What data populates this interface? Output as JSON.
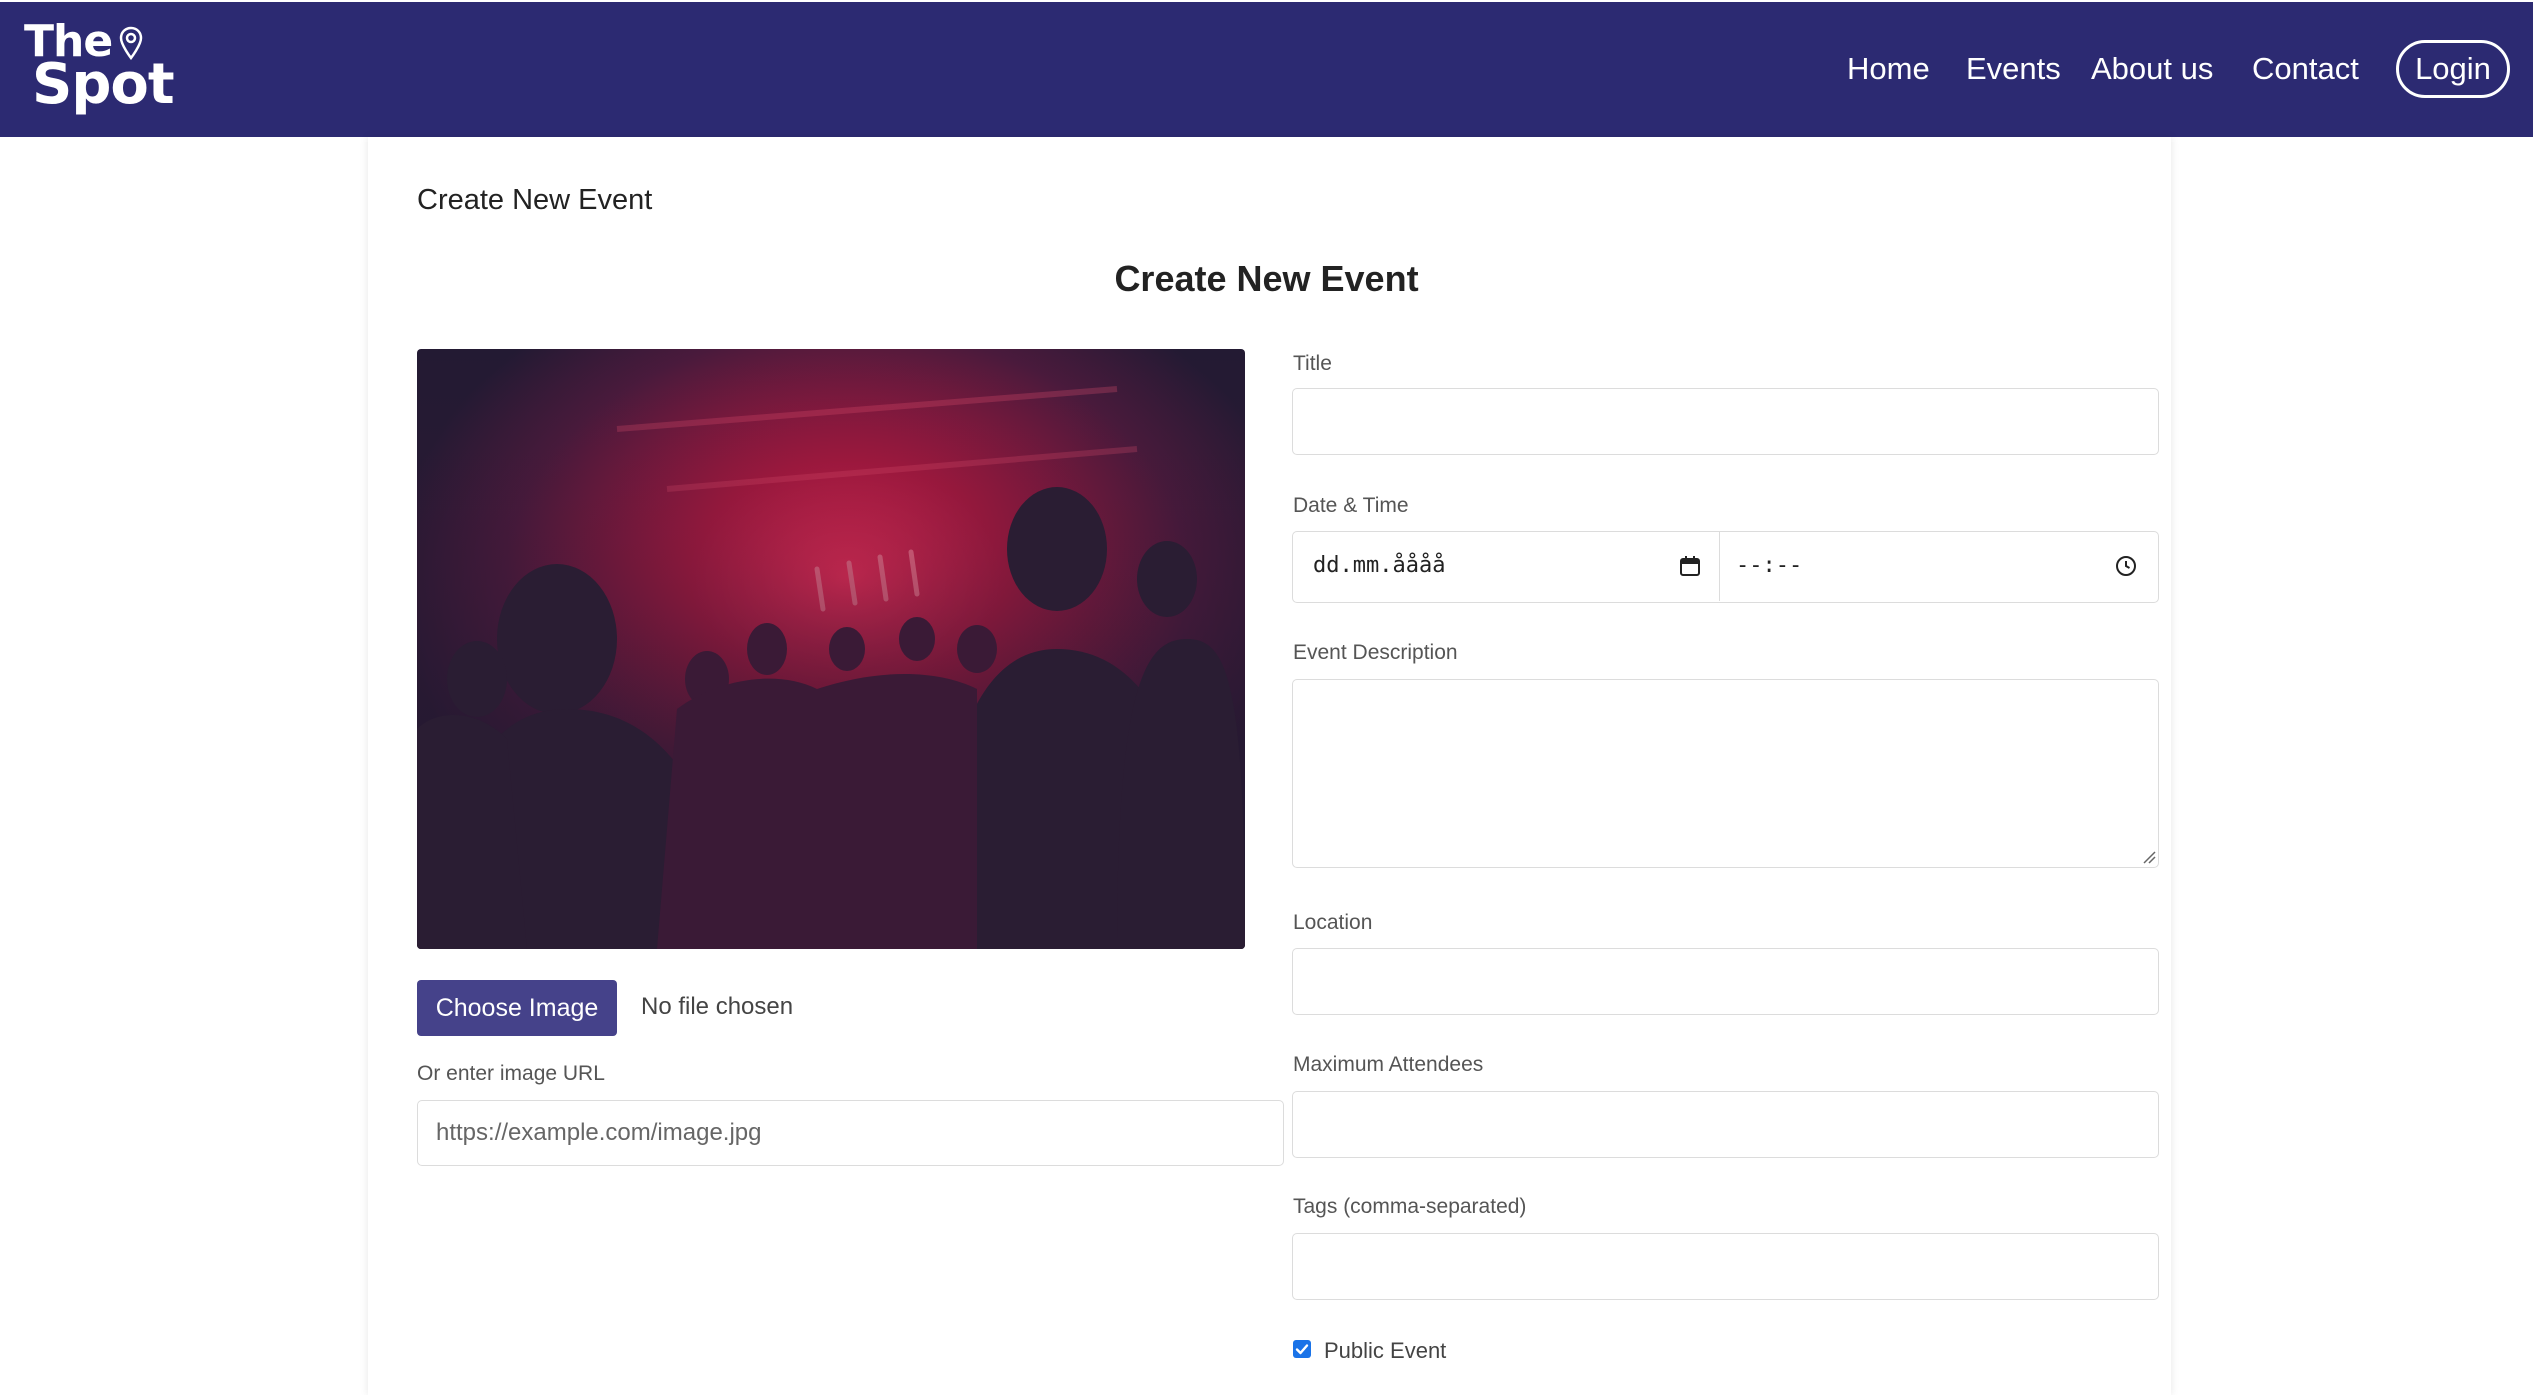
{
  "nav": {
    "logo_line1": "The",
    "logo_line2": "Spot",
    "links": [
      "Home",
      "Events",
      "About us",
      "Contact"
    ],
    "login": "Login"
  },
  "breadcrumb": "Create New Event",
  "page_title": "Create New Event",
  "image": {
    "choose_button": "Choose Image",
    "file_status": "No file chosen",
    "url_label": "Or enter image URL",
    "url_placeholder": "https://example.com/image.jpg",
    "url_value": ""
  },
  "form": {
    "title_label": "Title",
    "title_value": "",
    "datetime_label": "Date & Time",
    "date_placeholder": "dd.mm.åååå",
    "time_placeholder": "--:--",
    "description_label": "Event Description",
    "description_value": "",
    "location_label": "Location",
    "location_value": "",
    "max_label": "Maximum Attendees",
    "max_value": "",
    "tags_label": "Tags (comma-separated)",
    "tags_value": "",
    "public_label": "Public Event",
    "public_checked": true
  },
  "colors": {
    "navbar": "#2c2a72",
    "button": "#45428a",
    "checkbox": "#1a73e8"
  },
  "icons": {
    "logo_pin": "map-pin-icon",
    "date": "calendar-icon",
    "time": "clock-icon"
  }
}
